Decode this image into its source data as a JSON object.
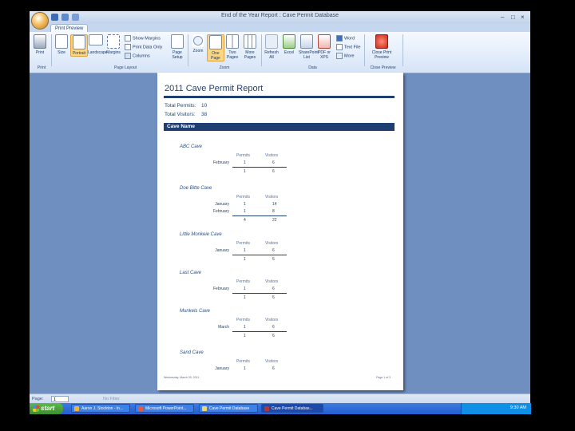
{
  "window": {
    "title": "End of the Year Report : Cave Permit Database"
  },
  "ribbon": {
    "tab": "Print Preview",
    "buttons": {
      "print": "Print",
      "size": "Size",
      "portrait": "Portrait",
      "landscape": "Landscape",
      "margins": "Margins",
      "show_margins": "Show Margins",
      "print_data_only": "Print Data Only",
      "columns": "Columns",
      "page_setup": "Page Setup",
      "zoom": "Zoom",
      "one_page": "One Page",
      "two_pages": "Two Pages",
      "more_pages": "More Pages",
      "refresh_all": "Refresh All",
      "excel": "Excel",
      "sharepoint": "SharePoint List",
      "pdf": "PDF or XPS",
      "word": "Word",
      "text_file": "Text File",
      "more": "More",
      "close_preview": "Close Print Preview"
    },
    "groups": {
      "print": "Print",
      "page_layout": "Page Layout",
      "zoom": "Zoom",
      "data": "Data",
      "close_preview": "Close Preview"
    }
  },
  "report": {
    "title": "2011 Cave Permit Report",
    "total_permits_label": "Total Permits:",
    "total_permits": "10",
    "total_visitors_label": "Total Visitors:",
    "total_visitors": "38",
    "header": "Cave Name",
    "col_permits": "Permits",
    "col_visitors": "Visitors",
    "caves": [
      {
        "name": "ABC Cave",
        "rows": [
          {
            "month": "February",
            "permits": "1",
            "visitors": "6"
          }
        ],
        "total_permits": "1",
        "total_visitors": "6"
      },
      {
        "name": "Doe Bitte Cave",
        "rows": [
          {
            "month": "January",
            "permits": "1",
            "visitors": "14"
          },
          {
            "month": "February",
            "permits": "1",
            "visitors": "8"
          }
        ],
        "total_permits": "4",
        "total_visitors": "22"
      },
      {
        "name": "Little Monkeie Cave",
        "rows": [
          {
            "month": "January",
            "permits": "1",
            "visitors": "6"
          }
        ],
        "total_permits": "1",
        "total_visitors": "6"
      },
      {
        "name": "Last Cave",
        "rows": [
          {
            "month": "February",
            "permits": "1",
            "visitors": "6"
          }
        ],
        "total_permits": "1",
        "total_visitors": "6"
      },
      {
        "name": "Munkels Cave",
        "rows": [
          {
            "month": "March",
            "permits": "1",
            "visitors": "6"
          }
        ],
        "total_permits": "1",
        "total_visitors": "6"
      },
      {
        "name": "Sand Cave",
        "rows": [
          {
            "month": "January",
            "permits": "1",
            "visitors": "6"
          }
        ]
      }
    ],
    "footer_date": "Wednesday, March 30, 2011",
    "footer_page": "Page 1 of 3"
  },
  "statusbar": {
    "page_label": "Page:",
    "page_value": "1",
    "filter": "No Filter"
  },
  "taskbar": {
    "start": "start",
    "tasks": [
      "Aaron J. Stockton - In...",
      "Microsoft PowerPoint...",
      "Cave Permit Database",
      "Cave Permit Databas..."
    ],
    "clock": "9:30 AM"
  }
}
